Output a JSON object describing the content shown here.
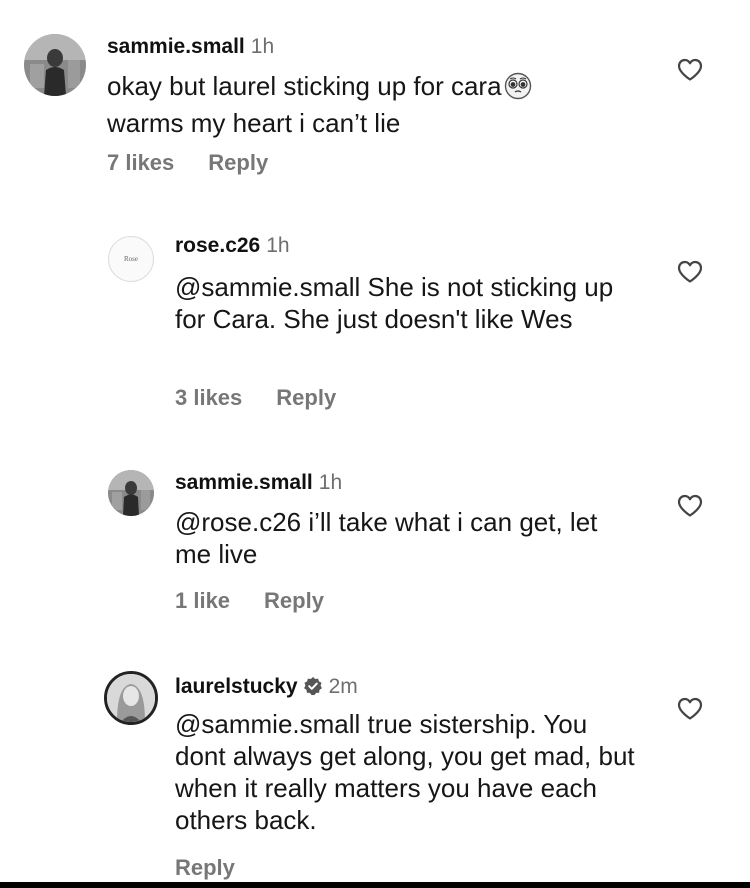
{
  "comments": [
    {
      "username": "sammie.small",
      "time": "1h",
      "text": "okay but laurel sticking up for cara",
      "text2": "warms my heart i can’t lie",
      "emoji": "pleading-face-emoji",
      "likes": "7 likes",
      "reply": "Reply"
    },
    {
      "username": "rose.c26",
      "time": "1h",
      "avatar_text": "Rose",
      "text": "@sammie.small She is not sticking up for Cara. She just doesn't like Wes",
      "likes": "3 likes",
      "reply": "Reply"
    },
    {
      "username": "sammie.small",
      "time": "1h",
      "text": "@rose.c26 i’ll take what i can get, let me live",
      "likes": "1 like",
      "reply": "Reply"
    },
    {
      "username": "laurelstucky",
      "time": "2m",
      "verified": true,
      "text": "@sammie.small true sistership. You dont always get along, you get mad, but when it really matters you have each others back.",
      "reply": "Reply"
    }
  ],
  "icons": {
    "like": "heart-outline-icon",
    "verified": "verified-badge-icon"
  },
  "colors": {
    "text": "#161616",
    "secondary": "#777777"
  }
}
